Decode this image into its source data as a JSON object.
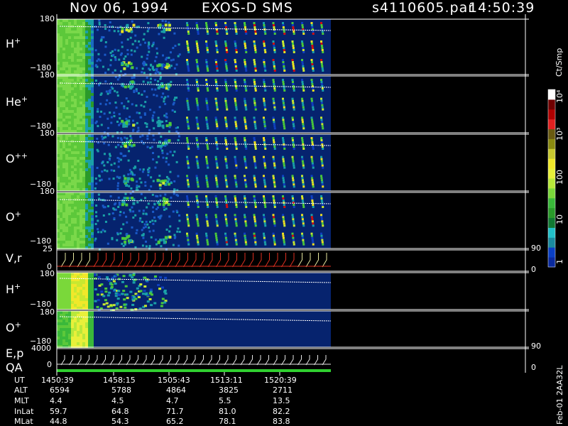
{
  "header": {
    "date": "Nov 06, 1994",
    "instrument": "EXOS-D SMS",
    "file": "s4110605.par",
    "time": "14:50:39"
  },
  "panels": [
    {
      "ion": "H",
      "charge": "+",
      "ymax": "180",
      "ymin": "−180"
    },
    {
      "ion": "He",
      "charge": "+",
      "ymax": "180",
      "ymin": "−180"
    },
    {
      "ion": "O",
      "charge": "++",
      "ymax": "180",
      "ymin": "−180"
    },
    {
      "ion": "O",
      "charge": "+",
      "ymax": "180",
      "ymin": "−180"
    }
  ],
  "vr_panel": {
    "label": "V,r",
    "ymax": "25",
    "ymin": "0",
    "right_max": "90",
    "right_min": "0"
  },
  "lower_panels": [
    {
      "ion": "H",
      "charge": "+",
      "ymax": "180",
      "ymin": "−180"
    },
    {
      "ion": "O",
      "charge": "+",
      "ymax": "180",
      "ymin": "−180"
    }
  ],
  "ep_panel": {
    "label1": "E,p",
    "label2": "QA",
    "ymax": "4000",
    "ymin": "0",
    "right_max": "90",
    "right_min": "0"
  },
  "colorbar": {
    "units": "Ct/Smp",
    "ticks": [
      "1",
      "10",
      "100",
      "10³",
      "10⁴"
    ],
    "colors": [
      "#0a2a9e",
      "#0a3fc4",
      "#1a8a9e",
      "#22c0c8",
      "#117a33",
      "#2a9a2a",
      "#3ab83a",
      "#7ad63a",
      "#b8e83a",
      "#e8f03a",
      "#f0e82a",
      "#c8c830",
      "#8a8a10",
      "#6a5a10",
      "#e02020",
      "#b00000",
      "#700000",
      "#ffffff"
    ]
  },
  "side_label": "Feb-01 2AA32L",
  "footer": {
    "rows": [
      {
        "label": "UT",
        "values": [
          "1450:39",
          "1458:15",
          "1505:43",
          "1513:11",
          "1520:39"
        ]
      },
      {
        "label": "ALT",
        "values": [
          "6594",
          "5788",
          "4864",
          "3825",
          "2711"
        ]
      },
      {
        "label": "MLT",
        "values": [
          "4.4",
          "4.5",
          "4.7",
          "5.5",
          "13.5"
        ]
      },
      {
        "label": "InLat",
        "values": [
          "59.7",
          "64.8",
          "71.7",
          "81.0",
          "82.2"
        ]
      },
      {
        "label": "MLat",
        "values": [
          "44.8",
          "54.3",
          "65.2",
          "78.1",
          "83.8"
        ]
      }
    ]
  },
  "chart_data": {
    "type": "heatmap",
    "title": "Nov 06, 1994   EXOS-D SMS",
    "x_ticks_ut": [
      "1450:39",
      "1458:15",
      "1505:43",
      "1513:11",
      "1520:39"
    ],
    "panels": [
      {
        "ion": "H+",
        "ylim": [
          -180,
          180
        ]
      },
      {
        "ion": "He+",
        "ylim": [
          -180,
          180
        ]
      },
      {
        "ion": "O++",
        "ylim": [
          -180,
          180
        ]
      },
      {
        "ion": "O+",
        "ylim": [
          -180,
          180
        ]
      },
      {
        "ion": "V,r",
        "ylim": [
          0,
          25
        ],
        "right_ylim": [
          0,
          90
        ]
      },
      {
        "ion": "H+",
        "ylim": [
          -180,
          180
        ]
      },
      {
        "ion": "O+",
        "ylim": [
          -180,
          180
        ]
      },
      {
        "ion": "E,p / QA",
        "ylim": [
          0,
          4000
        ],
        "right_ylim": [
          0,
          90
        ]
      }
    ],
    "color_scale": {
      "label": "Ct/Smp",
      "ticks": [
        "1",
        "10",
        "100",
        "10³",
        "10⁴"
      ]
    }
  }
}
